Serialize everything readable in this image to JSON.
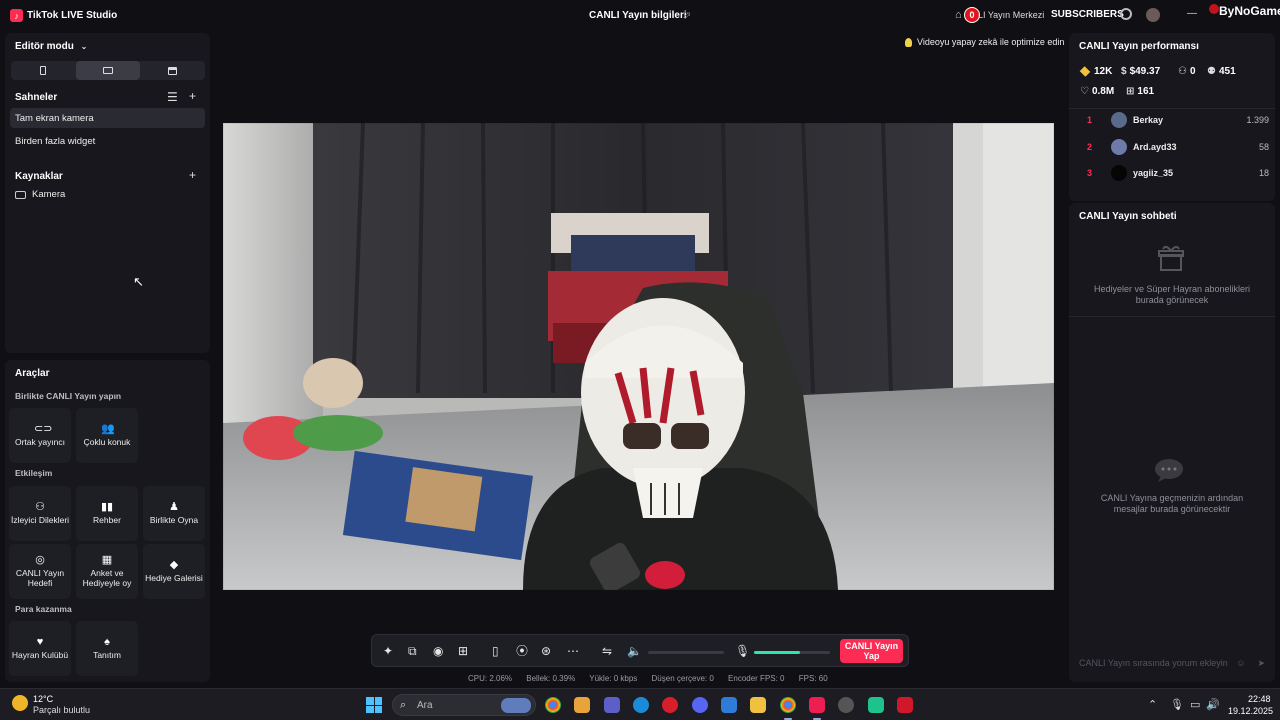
{
  "app": {
    "title": "TikTok LIVE Studio",
    "logo_glyph": "♪"
  },
  "header": {
    "stream_info": "CANLI Yayın bilgileri",
    "notification_count": "0",
    "live_center": "LI Yayın Merkezi",
    "subscribers": "SUBSCRIBERS",
    "minimize": "—",
    "brand": "ByNoGame"
  },
  "left": {
    "editor_mode": "Editör modu",
    "scenes_title": "Sahneler",
    "scenes": [
      "Tam ekran kamera",
      "Birden fazla widget"
    ],
    "sources_title": "Kaynaklar",
    "sources": [
      "Kamera"
    ],
    "tools_title": "Araçlar",
    "group_together": "Birlikte CANLI Yayın yapın",
    "group_interaction": "Etkileşim",
    "group_monetize": "Para kazanma",
    "tools": {
      "cohost": "Ortak yayıncı",
      "multiguest": "Çoklu konuk",
      "viewer_requests": "İzleyici Dilekleri",
      "guide": "Rehber",
      "play_together": "Birlikte Oyna",
      "live_goal": "CANLI Yayın Hedefi",
      "poll": "Anket ve Hediyeyle oy",
      "gift_gallery": "Hediye Galerisi",
      "fan_club": "Hayran Kulübü",
      "promote": "Tanıtım"
    }
  },
  "preview": {
    "ai_hint": "Videoyu yapay zekâ ile optimize edin"
  },
  "controls": {
    "go_live": "CANLI Yayın Yap",
    "speaker_level": 0,
    "mic_level": 0.6
  },
  "stats": {
    "cpu": "CPU:  2.06%",
    "memory": "Bellek:  0.39%",
    "upload": "Yükle:  0 kbps",
    "dropped": "Düşen çerçeve:  0",
    "encoder_fps": "Encoder FPS:  0",
    "fps": "FPS:  60"
  },
  "right": {
    "perf_title": "CANLI Yayın performansı",
    "diamonds": "12K",
    "earnings": "$49.37",
    "new_followers": "0",
    "viewers": "451",
    "likes": "0.8M",
    "gifts": "161",
    "ranking": [
      {
        "rank": "1",
        "name": "Berkay",
        "score": "1.399"
      },
      {
        "rank": "2",
        "name": "Ard.ayd33",
        "score": "58"
      },
      {
        "rank": "3",
        "name": "yagiiz_35",
        "score": "18"
      }
    ],
    "chat_title": "CANLI Yayın sohbeti",
    "gifts_empty": "Hediyeler ve Süper Hayran abonelikleri burada görünecek",
    "chat_empty": "CANLI Yayına geçmenizin ardından mesajlar burada görünecektir",
    "chat_placeholder": "CANLI Yayın sırasında yorum ekleyin"
  },
  "taskbar": {
    "temperature": "12°C",
    "weather": "Parçalı bulutlu",
    "search_placeholder": "Ara",
    "time": "22:48",
    "date": "19.12.2025"
  }
}
